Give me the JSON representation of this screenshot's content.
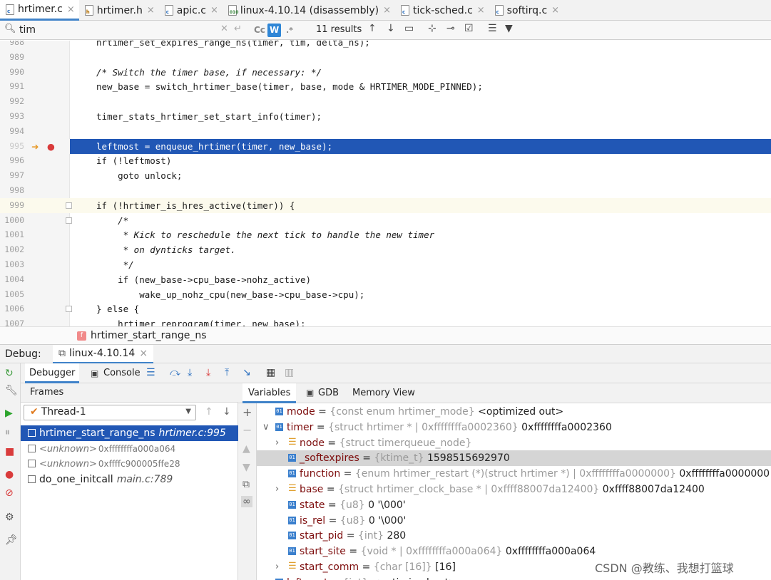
{
  "tabs": [
    {
      "label": "hrtimer.c",
      "kind": "c",
      "active": true
    },
    {
      "label": "hrtimer.h",
      "kind": "h",
      "active": false
    },
    {
      "label": "apic.c",
      "kind": "c",
      "active": false
    },
    {
      "label": "linux-4.10.14 (disassembly)",
      "kind": "d",
      "active": false
    },
    {
      "label": "tick-sched.c",
      "kind": "c",
      "active": false
    },
    {
      "label": "softirq.c",
      "kind": "c",
      "active": false
    }
  ],
  "search": {
    "value": "tim",
    "match_case_label": "Cc",
    "words_label": "W",
    "regex_label": ".*",
    "results": "11 results"
  },
  "editor": {
    "lines": [
      {
        "n": "988",
        "code": "hrtimer_set_expires_range_ns(timer, tim, delta_ns);"
      },
      {
        "n": "989",
        "code": ""
      },
      {
        "n": "990",
        "code": "/* Switch the timer base, if necessary: */",
        "comment": true
      },
      {
        "n": "991",
        "code": "new_base = switch_hrtimer_base(timer, base, mode & HRTIMER_MODE_PINNED);"
      },
      {
        "n": "992",
        "code": ""
      },
      {
        "n": "993",
        "code": "timer_stats_hrtimer_set_start_info(timer);"
      },
      {
        "n": "994",
        "code": ""
      },
      {
        "n": "995",
        "code": "leftmost = enqueue_hrtimer(timer, new_base);",
        "selected": true
      },
      {
        "n": "996",
        "code": "if (!leftmost)"
      },
      {
        "n": "997",
        "code": "    goto unlock;"
      },
      {
        "n": "998",
        "code": ""
      },
      {
        "n": "999",
        "code": "if (!hrtimer_is_hres_active(timer)) {",
        "current": true
      },
      {
        "n": "1000",
        "code": "    /*",
        "comment": true
      },
      {
        "n": "1001",
        "code": "     * Kick to reschedule the next tick to handle the new timer",
        "comment": true
      },
      {
        "n": "1002",
        "code": "     * on dynticks target.",
        "comment": true
      },
      {
        "n": "1003",
        "code": "     */",
        "comment": true
      },
      {
        "n": "1004",
        "code": "    if (new_base->cpu_base->nohz_active)"
      },
      {
        "n": "1005",
        "code": "        wake_up_nohz_cpu(new_base->cpu_base->cpu);"
      },
      {
        "n": "1006",
        "code": "} else {"
      },
      {
        "n": "1007",
        "code": "    hrtimer_reprogram(timer, new_base);"
      }
    ]
  },
  "breadcrumb": {
    "icon": "f",
    "label": "hrtimer_start_range_ns"
  },
  "debug": {
    "label": "Debug:",
    "session": "linux-4.10.14"
  },
  "debugger_tabs": {
    "debugger": "Debugger",
    "console": "Console"
  },
  "frames": {
    "header": "Frames",
    "thread": "Thread-1",
    "rows": [
      {
        "name": "hrtimer_start_range_ns",
        "loc": "hrtimer.c:995",
        "selected": true
      },
      {
        "name": "<unknown>",
        "loc": "0xffffffffa000a064",
        "unknown": true
      },
      {
        "name": "<unknown>",
        "loc": "0xffffc900005ffe28",
        "unknown": true
      },
      {
        "name": "do_one_initcall",
        "loc": "main.c:789"
      }
    ]
  },
  "variables_tabs": {
    "variables": "Variables",
    "gdb": "GDB",
    "memory": "Memory View"
  },
  "variables": [
    {
      "depth": 0,
      "expander": "",
      "icon": "01",
      "name": "mode",
      "type": "{const enum hrtimer_mode}",
      "value": "<optimized out>"
    },
    {
      "depth": 0,
      "expander": "v",
      "icon": "01",
      "name": "timer",
      "type": "{struct hrtimer * | 0xffffffffa0002360}",
      "value": "0xffffffffa0002360"
    },
    {
      "depth": 1,
      "expander": ">",
      "icon": "struct",
      "name": "node",
      "type": "{struct timerqueue_node}",
      "value": ""
    },
    {
      "depth": 1,
      "expander": "",
      "icon": "01",
      "name": "_softexpires",
      "type": "{ktime_t}",
      "value": "1598515692970",
      "highlight": true
    },
    {
      "depth": 1,
      "expander": "",
      "icon": "01",
      "name": "function",
      "type": "{enum hrtimer_restart (*)(struct hrtimer *) | 0xffffffffa0000000}",
      "value": "0xffffffffa0000000"
    },
    {
      "depth": 1,
      "expander": ">",
      "icon": "struct",
      "name": "base",
      "type": "{struct hrtimer_clock_base * | 0xffff88007da12400}",
      "value": "0xffff88007da12400"
    },
    {
      "depth": 1,
      "expander": "",
      "icon": "01",
      "name": "state",
      "type": "{u8}",
      "value": "0 '\\000'"
    },
    {
      "depth": 1,
      "expander": "",
      "icon": "01",
      "name": "is_rel",
      "type": "{u8}",
      "value": "0 '\\000'"
    },
    {
      "depth": 1,
      "expander": "",
      "icon": "01",
      "name": "start_pid",
      "type": "{int}",
      "value": "280"
    },
    {
      "depth": 1,
      "expander": "",
      "icon": "01",
      "name": "start_site",
      "type": "{void * | 0xffffffffa000a064}",
      "value": "0xffffffffa000a064"
    },
    {
      "depth": 1,
      "expander": ">",
      "icon": "struct",
      "name": "start_comm",
      "type": "{char [16]}",
      "value": "[16]"
    },
    {
      "depth": 0,
      "expander": "",
      "icon": "01",
      "name": "leftmost",
      "type": "{int}",
      "value": "<optimized out>"
    }
  ],
  "watermark": "CSDN @教练、我想打篮球"
}
